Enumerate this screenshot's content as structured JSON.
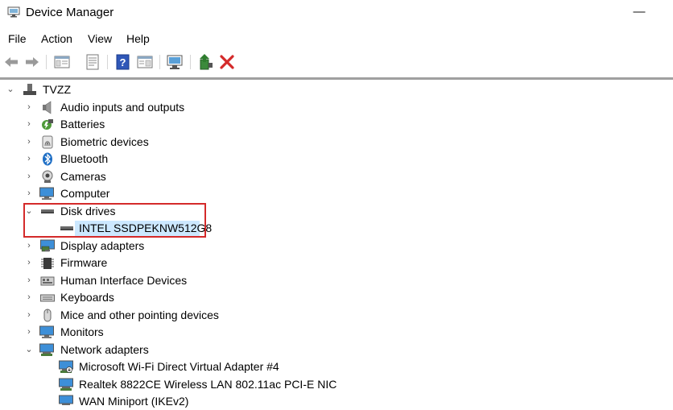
{
  "window": {
    "title": "Device Manager",
    "minimize_glyph": "—"
  },
  "menu": [
    "File",
    "Action",
    "View",
    "Help"
  ],
  "toolbar": {
    "buttons": [
      "back-icon",
      "forward-icon",
      "show-hide-console-tree-icon",
      "properties-icon",
      "help-icon",
      "action-pane-icon",
      "scan-hardware-changes-icon",
      "update-driver-icon",
      "uninstall-device-icon"
    ],
    "accent_red": "#d42a2a"
  },
  "tree": {
    "root": "TVZZ",
    "items": [
      "Audio inputs and outputs",
      "Batteries",
      "Biometric devices",
      "Bluetooth",
      "Cameras",
      "Computer",
      "Disk drives",
      "INTEL SSDPEKNW512G8",
      "Display adapters",
      "Firmware",
      "Human Interface Devices",
      "Keyboards",
      "Mice and other pointing devices",
      "Monitors",
      "Network adapters",
      "Microsoft Wi-Fi Direct Virtual Adapter #4",
      "Realtek 8822CE Wireless LAN 802.11ac PCI-E NIC",
      "WAN Miniport (IKEv2)"
    ],
    "selected": "INTEL SSDPEKNW512G8"
  },
  "colors": {
    "selection": "#cce8ff",
    "callout_border": "#d42a2a"
  }
}
